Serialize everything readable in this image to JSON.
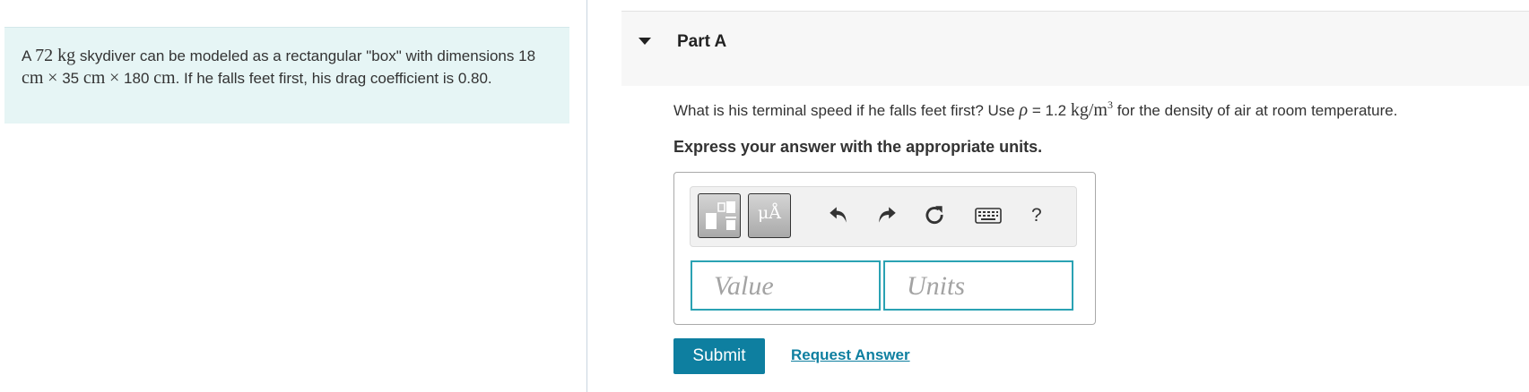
{
  "problem": {
    "t1": "A ",
    "mass_value": "72",
    "mass_unit": "kg",
    "t2": " skydiver can be modeled as a rectangular \"box\" with dimensions ",
    "dim1_value": "18",
    "dim1_unit": "cm",
    "times_1": "×",
    "dim2_value": "35",
    "dim2_unit": "cm",
    "times_2": "×",
    "dim3_value": "180",
    "dim3_unit": "cm",
    "t3": ". If he falls feet first, his drag coefficient is 0.80."
  },
  "part": {
    "title": "Part A",
    "question_pre": "What is his terminal speed if he falls feet first? Use ",
    "rho_symbol": "ρ",
    "rho_eq": " = 1.2 ",
    "rho_unit": "kg/m",
    "rho_exp": "3",
    "question_post": " for the density of air at room temperature.",
    "instruction": "Express your answer with the appropriate units."
  },
  "toolbar": {
    "units_button_label": "μÅ",
    "help_label": "?",
    "icons": [
      "templates-icon",
      "units-icon",
      "undo-icon",
      "redo-icon",
      "reset-icon",
      "keyboard-icon",
      "help-icon"
    ]
  },
  "answer": {
    "value_placeholder": "Value",
    "units_placeholder": "Units"
  },
  "actions": {
    "submit_label": "Submit",
    "request_label": "Request Answer"
  },
  "colors": {
    "accent": "#0e7fa0",
    "field_border": "#2aa2b3",
    "problem_bg": "#e6f5f5"
  }
}
